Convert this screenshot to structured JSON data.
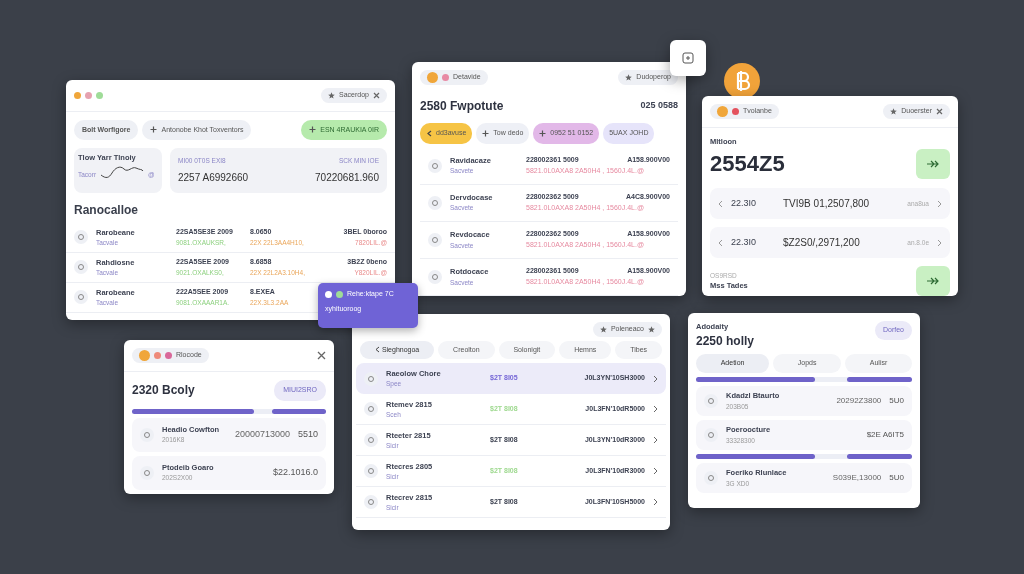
{
  "panel_a": {
    "dots": [
      {
        "color": "#f0a63a"
      },
      {
        "color": "#e6a2b0"
      },
      {
        "color": "#9fdc98"
      }
    ],
    "menu_pill": {
      "label": "Sacerdop"
    },
    "buttons": [
      {
        "label": "Bolt Worfigore",
        "kind": "plain"
      },
      {
        "label": "Antonobe Khot Toxventors",
        "kind": "add"
      },
      {
        "label": "ESN 4RAUKIA 0IR",
        "kind": "primary"
      }
    ],
    "trend_card": {
      "title": "Tlow Yarr Tlnoiy",
      "caption": "Tacorr",
      "badge": "@"
    },
    "stat": {
      "label_1": "MI00 0T0S EXI8",
      "label_2": "SCK MIN IOE",
      "value_1": "2257 A6992660",
      "value_2": "70220681.960"
    },
    "heading": "Ranocalloe",
    "rows": [
      {
        "name": "Rarobeane",
        "sub": "Tacvale",
        "col_1": "22SA5SE3E 2009",
        "col_1_sub": "9081.OXAUKSR,",
        "col_2": "8.0650",
        "col_2_sub": "22X 22L3AA4H10,",
        "col_3": "3BEL 0boroo",
        "col_3_sub": "7820LIL.@"
      },
      {
        "name": "Rahdiosne",
        "sub": "Tacvale",
        "col_1": "22SA5SEE 2009",
        "col_1_sub": "9021.OXALKS0,",
        "col_2": "8.6858",
        "col_2_sub": "22X 22L2A3.10H4,",
        "col_3": "3B2Z 0beno",
        "col_3_sub": "Y820LIL.@"
      },
      {
        "name": "Rarobeane",
        "sub": "Tacvale",
        "col_1": "222A5SEE 2009",
        "col_1_sub": "9081.OXAAAR1A.",
        "col_2": "8.EXEA",
        "col_2_sub": "22X.3L3.2AA"
      }
    ]
  },
  "tooltip": {
    "title": "Rehe:ktape 7C",
    "text": "xyhituoroog"
  },
  "panel_b": {
    "tag": "Detavide",
    "menu_pill": {
      "label": "Dudoperop"
    },
    "title": "2580 Fwpotute",
    "total": "025 0588",
    "filters": [
      {
        "label": "dd3avuse",
        "color": "#f6c445"
      },
      {
        "label": "Tow dedo",
        "color": "#eef0f6"
      },
      {
        "label": "0952 51 0152",
        "color": "#e2b8e8"
      },
      {
        "label": "5UAX JOHD",
        "color": "#e6e4fa"
      }
    ],
    "rows": [
      {
        "name": "Ravidacaze",
        "sub": "Sacvete",
        "ref": "228002361 5009",
        "detail": "5821.0L0AXA8 2A50H4 ,  1560J.4L.@",
        "amount": "A158.900V00"
      },
      {
        "name": "Dervdocase",
        "sub": "Sacvete",
        "ref": "228002362 5009",
        "detail": "5821.0L0AXA8 2A50H4 ,  1560J.4L.@",
        "amount": "A4C8.900V00"
      },
      {
        "name": "Revdocace",
        "sub": "Sacvete",
        "ref": "228002362 5009",
        "detail": "5821.0L0AXA8 2A50H4 ,  1560J.4L.@",
        "amount": "A158.900V00"
      },
      {
        "name": "Rotdocace",
        "sub": "Sacvete",
        "ref": "228002361 5009",
        "detail": "5821.0L0AXA8 2A50H4 ,  1560J.4L.@",
        "amount": "A158.900V00"
      }
    ]
  },
  "panel_c": {
    "tag": "Tvolanbe",
    "menu_pill": {
      "label": "Duoerster"
    },
    "label": "Mltloon",
    "value": "2554Z5",
    "rows": [
      {
        "left": "22.3I0",
        "amount": "TVI9B 01,2507,800",
        "note": "ana8ua"
      },
      {
        "left": "22.3I0",
        "amount": "$Z2S0/,2971,200",
        "note": "an.8.0e"
      }
    ],
    "footer_label": "OS9RSD",
    "footer_title": "Mss Tades"
  },
  "panel_d": {
    "tag": "Rlocode",
    "title": "2320 Bcoly",
    "button": "MIUI2SRO",
    "bar": {
      "left": {
        "level": 0.63
      },
      "right": {
        "level": 0.28
      }
    },
    "rows": [
      {
        "name": "Headio Cowfton",
        "sub": "2016K8",
        "amount": "20000713000",
        "value": "5510"
      },
      {
        "name": "Ptodeib Goaro",
        "sub": "202S2X00",
        "value": "$22.1016.0"
      }
    ]
  },
  "panel_e": {
    "menu_pill": {
      "label": "Poleneaco"
    },
    "tabs": [
      {
        "label": "Sieghnogoa",
        "selected": true
      },
      {
        "label": "Creolton",
        "selected": false
      },
      {
        "label": "Solonigit",
        "selected": false
      },
      {
        "label": "Hemns",
        "selected": false
      },
      {
        "label": "Tibes",
        "selected": false
      }
    ],
    "rows": [
      {
        "name": "Raeolow Chore",
        "sub": "Spee",
        "amount": "$2T 8I05",
        "color": "#7566d6",
        "total": "J0L3YN'10SH3000",
        "selected": true
      },
      {
        "name": "Rtemev 2815",
        "sub": "Sceh",
        "amount": "$2T 8I08",
        "color": "#9ed98f",
        "total": "J0L3FN'10dR5000",
        "selected": false
      },
      {
        "name": "Rteeter 2815",
        "sub": "Sicir",
        "amount": "$2T 8I08",
        "color": "#3c4150",
        "total": "J0L3YN'10dR3000",
        "selected": false
      },
      {
        "name": "Rtecres 2805",
        "sub": "Sicir",
        "amount": "$2T 8I08",
        "color": "#9ed98f",
        "total": "J0L3FN'10dR3000",
        "selected": false
      },
      {
        "name": "Rtecrev 2815",
        "sub": "Sicir",
        "amount": "$2T 8I08",
        "color": "#3c4150",
        "total": "J0L3FN'10SH5000",
        "selected": false
      }
    ]
  },
  "panel_f": {
    "label": "Adodaity",
    "title": "2250 holly",
    "button": "Dorfeo",
    "tabs": [
      {
        "label": "Adetion",
        "selected": true
      },
      {
        "label": "Jopds",
        "selected": false
      },
      {
        "label": "Aulisr",
        "selected": false
      }
    ],
    "bar": {
      "left": {
        "level": 0.55
      },
      "right": {
        "level": 0.3
      }
    },
    "rows": [
      {
        "name": "Kdadzl Btaurto",
        "sub": "203B05",
        "amount": "20292Z3800",
        "value": "5U0"
      },
      {
        "name": "Poeroocture",
        "sub": "33328300",
        "value": "$2E A6IT5"
      }
    ],
    "bar_2": {
      "left": {
        "level": 0.55
      },
      "right": {
        "level": 0.3
      }
    },
    "rows_2": [
      {
        "name": "Foeriko Rlunlace",
        "sub": "3G XD0",
        "amount": "S039E,13000",
        "value": "5U0"
      }
    ]
  }
}
